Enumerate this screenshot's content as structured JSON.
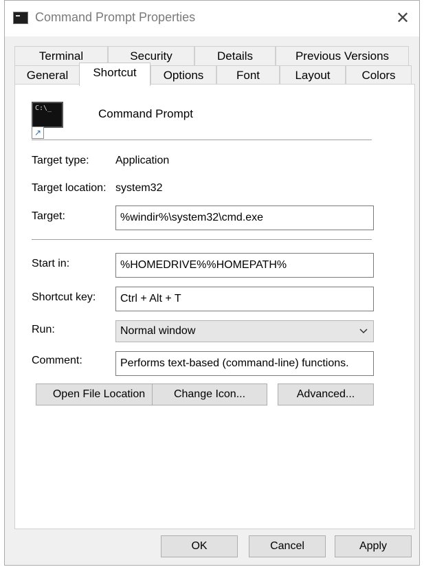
{
  "window": {
    "title": "Command Prompt Properties",
    "title_icon": "cmd-window-icon",
    "close_glyph": "✕"
  },
  "tabs": {
    "row1": [
      "Terminal",
      "Security",
      "Details",
      "Previous Versions"
    ],
    "row2": [
      "General",
      "Shortcut",
      "Options",
      "Font",
      "Layout",
      "Colors"
    ],
    "active": "Shortcut"
  },
  "shortcut": {
    "icon_prompt": "C:\\_",
    "icon_arrow": "↗",
    "app_name": "Command Prompt",
    "target_type_label": "Target type:",
    "target_type_value": "Application",
    "target_location_label": "Target location:",
    "target_location_value": "system32",
    "target_label": "Target:",
    "target_value": "%windir%\\system32\\cmd.exe",
    "start_in_label": "Start in:",
    "start_in_value": "%HOMEDRIVE%%HOMEPATH%",
    "shortcut_key_label": "Shortcut key:",
    "shortcut_key_value": "Ctrl + Alt + T",
    "run_label": "Run:",
    "run_value": "Normal window",
    "comment_label": "Comment:",
    "comment_value": "Performs text-based (command-line) functions.",
    "open_file_location": "Open File Location",
    "change_icon": "Change Icon...",
    "advanced": "Advanced..."
  },
  "footer": {
    "ok": "OK",
    "cancel": "Cancel",
    "apply": "Apply"
  }
}
